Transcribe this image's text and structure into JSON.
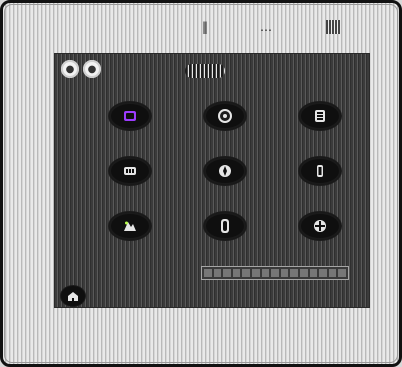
{
  "status": {
    "left": "‖",
    "mid": "…",
    "right": ""
  },
  "top_controls": {
    "a": "●",
    "b": "●"
  },
  "header": {
    "title": "",
    "subtitle": ""
  },
  "tiles": [
    {
      "label": "",
      "icon": "app-icon"
    },
    {
      "label": "",
      "icon": "app-icon"
    },
    {
      "label": "",
      "icon": "app-icon"
    },
    {
      "label": "",
      "icon": "app-icon"
    },
    {
      "label": "",
      "icon": "app-icon"
    },
    {
      "label": "",
      "icon": "app-icon"
    },
    {
      "label": "",
      "icon": "app-icon"
    },
    {
      "label": "",
      "icon": "app-icon"
    },
    {
      "label": "",
      "icon": "app-icon"
    }
  ],
  "progress": {
    "value": 0.0,
    "segments": 15
  }
}
